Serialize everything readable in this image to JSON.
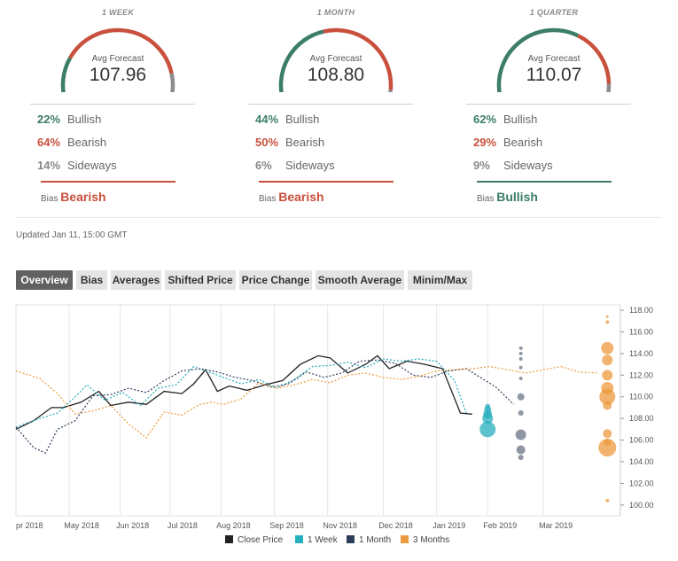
{
  "gauges": [
    {
      "period": "1 WEEK",
      "avg_label": "Avg Forecast",
      "avg_value": "107.96",
      "stats": [
        {
          "pct": "22%",
          "label": "Bullish",
          "color": "#3b7d66"
        },
        {
          "pct": "64%",
          "label": "Bearish",
          "color": "#c8503c"
        },
        {
          "pct": "14%",
          "label": "Sideways",
          "color": "#888888"
        }
      ],
      "arc": {
        "bullish": 0.22,
        "bearish": 0.64,
        "sideways": 0.14
      },
      "bias_label": "Bias",
      "bias_value": "Bearish",
      "bias_color": "#c8503c"
    },
    {
      "period": "1 MONTH",
      "avg_label": "Avg Forecast",
      "avg_value": "108.80",
      "stats": [
        {
          "pct": "44%",
          "label": "Bullish",
          "color": "#3b7d66"
        },
        {
          "pct": "50%",
          "label": "Bearish",
          "color": "#c8503c"
        },
        {
          "pct": "6%",
          "label": "Sideways",
          "color": "#888888"
        }
      ],
      "arc": {
        "bullish": 0.44,
        "bearish": 0.5,
        "sideways": 0.06
      },
      "bias_label": "Bias",
      "bias_value": "Bearish",
      "bias_color": "#c8503c"
    },
    {
      "period": "1 QUARTER",
      "avg_label": "Avg Forecast",
      "avg_value": "110.07",
      "stats": [
        {
          "pct": "62%",
          "label": "Bullish",
          "color": "#3b7d66"
        },
        {
          "pct": "29%",
          "label": "Bearish",
          "color": "#c8503c"
        },
        {
          "pct": "9%",
          "label": "Sideways",
          "color": "#888888"
        }
      ],
      "arc": {
        "bullish": 0.62,
        "bearish": 0.29,
        "sideways": 0.09
      },
      "bias_label": "Bias",
      "bias_value": "Bullish",
      "bias_color": "#3b7d66"
    }
  ],
  "updated": "Updated Jan 11, 15:00 GMT",
  "tabs": [
    "Overview",
    "Bias",
    "Averages",
    "Shifted Price",
    "Price Change",
    "Smooth Average",
    "Minim/Max"
  ],
  "active_tab": "Overview",
  "chart_data": {
    "type": "line",
    "x_tick_labels": [
      "pr 2018",
      "May 2018",
      "Jun 2018",
      "Jul 2018",
      "Aug 2018",
      "Sep 2018",
      "Nov 2018",
      "Dec 2018",
      "Jan 2019",
      "Feb 2019",
      "Mar 2019"
    ],
    "y_tick_labels": [
      "100.00",
      "102.00",
      "104.00",
      "106.00",
      "108.00",
      "110.00",
      "112.00",
      "114.00",
      "116.00",
      "118.00"
    ],
    "ylim": [
      99,
      118.5
    ],
    "x_unit": "weeks since start of axis",
    "xlim": [
      0,
      51
    ],
    "legend_position": "bottom",
    "series": [
      {
        "name": "Close Price",
        "color": "#222222",
        "dashed": false,
        "points": [
          [
            0,
            107.0
          ],
          [
            1.5,
            107.8
          ],
          [
            3,
            109.0
          ],
          [
            4,
            109.0
          ],
          [
            5.5,
            109.5
          ],
          [
            7,
            110.5
          ],
          [
            8,
            109.2
          ],
          [
            9.5,
            109.5
          ],
          [
            11,
            109.3
          ],
          [
            12.5,
            110.5
          ],
          [
            14,
            110.3
          ],
          [
            15,
            111.2
          ],
          [
            16,
            112.5
          ],
          [
            17,
            110.5
          ],
          [
            18,
            111.0
          ],
          [
            19.5,
            110.6
          ],
          [
            21,
            111.1
          ],
          [
            22.5,
            111.5
          ],
          [
            24,
            113.0
          ],
          [
            25.5,
            113.8
          ],
          [
            26.5,
            113.6
          ],
          [
            28,
            112.2
          ],
          [
            29.5,
            113.0
          ],
          [
            30.5,
            113.8
          ],
          [
            31.5,
            112.6
          ],
          [
            33,
            113.3
          ],
          [
            34.5,
            113.0
          ],
          [
            36,
            112.6
          ],
          [
            37.5,
            108.5
          ],
          [
            38.5,
            108.4
          ]
        ]
      },
      {
        "name": "1 Week",
        "color": "#26aebd",
        "dashed": true,
        "points": [
          [
            0,
            107.2
          ],
          [
            2,
            108.0
          ],
          [
            3.5,
            108.5
          ],
          [
            5,
            110.0
          ],
          [
            6,
            111.1
          ],
          [
            7.5,
            109.7
          ],
          [
            9,
            110.4
          ],
          [
            10.5,
            109.2
          ],
          [
            12,
            110.8
          ],
          [
            13.5,
            111.1
          ],
          [
            15,
            112.8
          ],
          [
            16.5,
            112.2
          ],
          [
            17.5,
            111.8
          ],
          [
            19,
            111.2
          ],
          [
            20.5,
            111.6
          ],
          [
            22,
            110.8
          ],
          [
            23.5,
            111.6
          ],
          [
            25,
            112.8
          ],
          [
            26.5,
            112.9
          ],
          [
            28,
            113.2
          ],
          [
            29.5,
            112.7
          ],
          [
            31,
            113.5
          ],
          [
            32.5,
            113.3
          ],
          [
            34,
            113.5
          ],
          [
            35.5,
            113.3
          ],
          [
            37,
            111.5
          ],
          [
            38,
            108.5
          ]
        ]
      },
      {
        "name": "1 Month",
        "color": "#2d3e5b",
        "dashed": true,
        "points": [
          [
            0,
            107.2
          ],
          [
            1.5,
            105.3
          ],
          [
            2.5,
            104.8
          ],
          [
            3.5,
            107.0
          ],
          [
            5,
            107.8
          ],
          [
            6.5,
            110.1
          ],
          [
            8,
            110.2
          ],
          [
            9.5,
            110.8
          ],
          [
            11,
            110.4
          ],
          [
            12.5,
            111.5
          ],
          [
            14,
            112.4
          ],
          [
            15.5,
            112.6
          ],
          [
            17,
            112.3
          ],
          [
            18.5,
            111.8
          ],
          [
            20,
            111.5
          ],
          [
            21.5,
            110.9
          ],
          [
            23,
            111.2
          ],
          [
            24.5,
            112.3
          ],
          [
            26,
            111.8
          ],
          [
            27.5,
            112.2
          ],
          [
            29,
            113.3
          ],
          [
            30.5,
            113.4
          ],
          [
            32,
            113.1
          ],
          [
            33.5,
            112.0
          ],
          [
            35,
            111.8
          ],
          [
            36.5,
            112.4
          ],
          [
            38,
            112.6
          ],
          [
            40.5,
            110.9
          ],
          [
            42,
            109.3
          ]
        ]
      },
      {
        "name": "3 Months",
        "color": "#ec9a3d",
        "dashed": true,
        "points": [
          [
            0,
            112.4
          ],
          [
            2,
            111.7
          ],
          [
            3.5,
            110.3
          ],
          [
            5,
            108.4
          ],
          [
            6.5,
            108.7
          ],
          [
            8,
            109.2
          ],
          [
            9.5,
            107.5
          ],
          [
            11,
            106.2
          ],
          [
            12.5,
            108.6
          ],
          [
            14,
            108.3
          ],
          [
            15.5,
            109.3
          ],
          [
            16.5,
            109.5
          ],
          [
            17.5,
            109.3
          ],
          [
            19,
            109.8
          ],
          [
            20.5,
            111.3
          ],
          [
            22,
            110.8
          ],
          [
            23.5,
            111.1
          ],
          [
            25,
            111.6
          ],
          [
            26.5,
            111.3
          ],
          [
            28,
            112.0
          ],
          [
            29.5,
            112.2
          ],
          [
            31,
            111.8
          ],
          [
            32.5,
            111.6
          ],
          [
            34,
            111.9
          ],
          [
            35.5,
            112.4
          ],
          [
            37,
            112.5
          ],
          [
            38.5,
            112.6
          ],
          [
            40,
            112.8
          ],
          [
            41.5,
            112.5
          ],
          [
            43,
            112.2
          ],
          [
            44.5,
            112.5
          ],
          [
            46,
            112.8
          ],
          [
            47.5,
            112.3
          ],
          [
            49,
            112.2
          ]
        ]
      }
    ],
    "bubbles": [
      {
        "series": "1 Week",
        "x": 39.8,
        "color": "#26aebd",
        "points": [
          [
            107.0,
            9
          ],
          [
            108.0,
            6
          ],
          [
            108.4,
            5
          ],
          [
            108.8,
            4
          ],
          [
            109.1,
            3
          ]
        ]
      },
      {
        "series": "1 Month",
        "x": 42.6,
        "color": "#6b7486",
        "points": [
          [
            114.5,
            2
          ],
          [
            114.0,
            2
          ],
          [
            113.5,
            2
          ],
          [
            112.7,
            2
          ],
          [
            111.7,
            2
          ],
          [
            110.0,
            4
          ],
          [
            108.5,
            3
          ],
          [
            106.5,
            6
          ],
          [
            105.1,
            5
          ],
          [
            104.4,
            3
          ]
        ]
      },
      {
        "series": "3 Months",
        "x": 49.9,
        "color": "#ec9a3d",
        "points": [
          [
            117.4,
            1.5
          ],
          [
            116.9,
            2
          ],
          [
            114.5,
            7
          ],
          [
            113.4,
            6
          ],
          [
            112.0,
            6
          ],
          [
            110.8,
            7
          ],
          [
            110.0,
            9
          ],
          [
            109.2,
            5
          ],
          [
            106.6,
            5
          ],
          [
            105.8,
            4
          ],
          [
            105.3,
            10
          ],
          [
            100.4,
            2
          ]
        ]
      }
    ]
  }
}
